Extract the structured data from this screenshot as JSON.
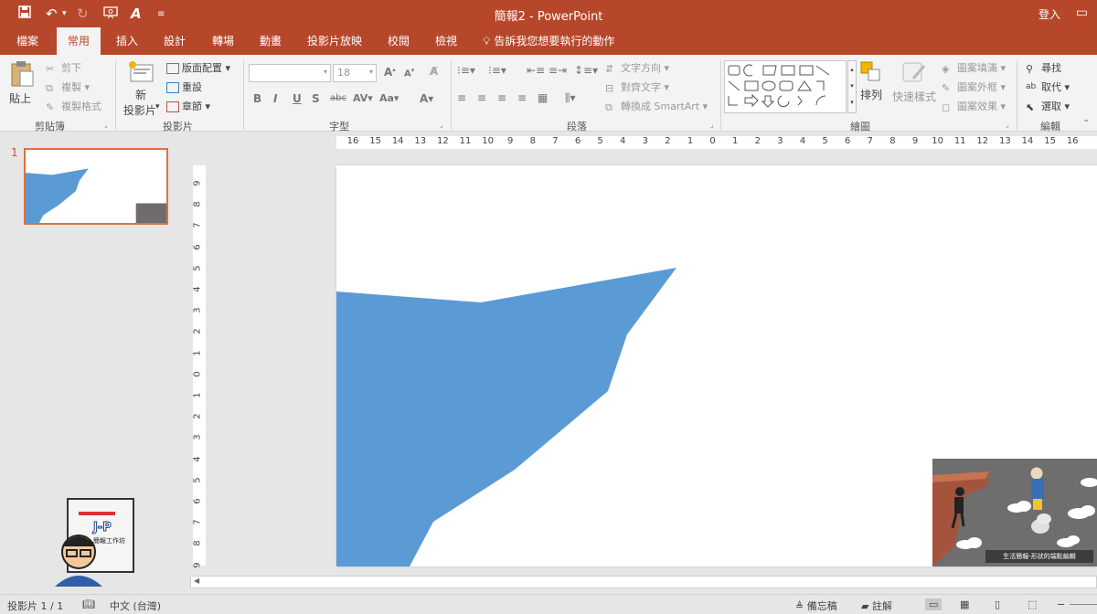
{
  "app": {
    "title": "簡報2 - PowerPoint",
    "sign_in": "登入"
  },
  "tabs": [
    {
      "label": "檔案",
      "active": false
    },
    {
      "label": "常用",
      "active": true
    },
    {
      "label": "插入",
      "active": false
    },
    {
      "label": "設計",
      "active": false
    },
    {
      "label": "轉場",
      "active": false
    },
    {
      "label": "動畫",
      "active": false
    },
    {
      "label": "投影片放映",
      "active": false
    },
    {
      "label": "校閱",
      "active": false
    },
    {
      "label": "檢視",
      "active": false
    }
  ],
  "tell_me": "告訴我您想要執行的動作",
  "ribbon": {
    "clipboard": {
      "paste": "貼上",
      "cut": "剪下",
      "copy": "複製",
      "format_painter": "複製格式",
      "label": "剪貼簿"
    },
    "slides": {
      "new_slide_line1": "新",
      "new_slide_line2": "投影片",
      "layout": "版面配置",
      "reset": "重設",
      "section": "章節",
      "label": "投影片"
    },
    "font": {
      "font_name": "",
      "font_size": "18",
      "label": "字型"
    },
    "paragraph": {
      "text_direction": "文字方向",
      "align_text": "對齊文字",
      "convert_smartart": "轉換成 SmartArt",
      "label": "段落"
    },
    "drawing": {
      "arrange": "排列",
      "quick_styles": "快速樣式",
      "shape_fill": "圖案填滿",
      "shape_outline": "圖案外框",
      "shape_effects": "圖案效果",
      "label": "繪圖"
    },
    "editing": {
      "find": "尋找",
      "replace": "取代",
      "select": "選取",
      "label": "編輯"
    }
  },
  "thumbnail": {
    "number": "1"
  },
  "slide": {
    "caption": "生活簡報-形狀的端點編輯",
    "shape_color": "#5b9bd5"
  },
  "rulers": {
    "horizontal": [
      "16",
      "15",
      "14",
      "13",
      "12",
      "11",
      "10",
      "9",
      "8",
      "7",
      "6",
      "5",
      "4",
      "3",
      "2",
      "1",
      "0",
      "1",
      "2",
      "3",
      "4",
      "5",
      "6",
      "7",
      "8",
      "9",
      "10",
      "11",
      "12",
      "13",
      "14",
      "15",
      "16"
    ],
    "vertical": [
      "9",
      "8",
      "7",
      "6",
      "5",
      "4",
      "3",
      "2",
      "1",
      "0",
      "1",
      "2",
      "3",
      "4",
      "5",
      "6",
      "7",
      "8",
      "9"
    ]
  },
  "status": {
    "slide_of": "投影片 1 / 1",
    "language": "中文 (台灣)",
    "notes": "備忘稿",
    "comments": "註解"
  },
  "logo": {
    "text": "J-P",
    "subtitle": "簡報工作坊"
  },
  "colors": {
    "accent": "#b7472a",
    "ribbon": "#f3f3f3",
    "shape": "#5b9bd5"
  }
}
